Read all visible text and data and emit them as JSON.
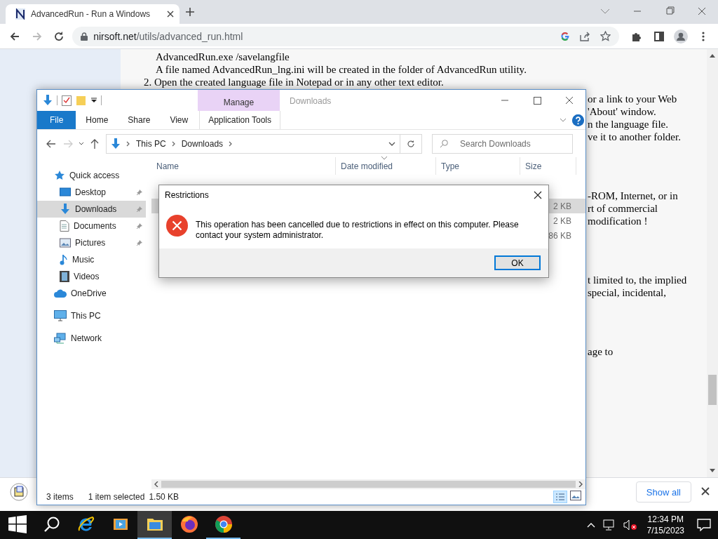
{
  "browser": {
    "tab": {
      "title": "AdvancedRun - Run a Windows"
    },
    "address": {
      "host": "nirsoft.net",
      "path": "/utils/advanced_run.html"
    },
    "page": {
      "lines": [
        {
          "kind": "plain",
          "text": "AdvancedRun.exe /savelangfile"
        },
        {
          "kind": "plain",
          "text": "A file named AdvancedRun_lng.ini will be created in the folder of AdvancedRun utility."
        },
        {
          "kind": "item",
          "marker": "2.",
          "text": "Open the created language file in Notepad or in any other text editor."
        }
      ],
      "fragments": [
        {
          "lines": [
            "or a link to your Web",
            "'About' window.",
            "n the language file.",
            "ve it to another folder."
          ]
        },
        {
          "lines": [
            "-ROM, Internet, or in",
            "rt of commercial",
            "modification !"
          ]
        },
        {
          "lines": [
            "t limited to, the implied",
            "special, incidental,"
          ]
        },
        {
          "lines": [
            "age to"
          ]
        }
      ]
    },
    "downloads_bar": {
      "button": "Show all"
    }
  },
  "explorer": {
    "title": "Downloads",
    "context_group": "Manage",
    "ribbon_tabs": [
      {
        "label": "File",
        "kind": "file"
      },
      {
        "label": "Home",
        "kind": "tab"
      },
      {
        "label": "Share",
        "kind": "tab"
      },
      {
        "label": "View",
        "kind": "tab"
      },
      {
        "label": "Application Tools",
        "kind": "contextual"
      }
    ],
    "breadcrumb": [
      "This PC",
      "Downloads"
    ],
    "search": {
      "placeholder": "Search Downloads"
    },
    "columns": [
      {
        "label": "Name",
        "sorted": false
      },
      {
        "label": "Date modified",
        "sorted": true
      },
      {
        "label": "Type",
        "sorted": false
      },
      {
        "label": "Size",
        "sorted": false
      }
    ],
    "nav": [
      {
        "label": "Quick access",
        "kind": "star",
        "selected": false,
        "children": [
          {
            "label": "Desktop",
            "kind": "desktop",
            "pinned": true,
            "selected": false
          },
          {
            "label": "Downloads",
            "kind": "download",
            "pinned": true,
            "selected": true
          },
          {
            "label": "Documents",
            "kind": "document",
            "pinned": true,
            "selected": false
          },
          {
            "label": "Pictures",
            "kind": "picture",
            "pinned": true,
            "selected": false
          },
          {
            "label": "Music",
            "kind": "music",
            "pinned": false,
            "selected": false
          },
          {
            "label": "Videos",
            "kind": "video",
            "pinned": false,
            "selected": false
          }
        ]
      },
      {
        "label": "OneDrive",
        "kind": "cloud",
        "selected": false
      },
      {
        "label": "This PC",
        "kind": "computer",
        "selected": false
      },
      {
        "label": "Network",
        "kind": "network",
        "selected": false
      }
    ],
    "rows": [
      {
        "size": "2 KB",
        "selected": true
      },
      {
        "size": "2 KB",
        "selected": false
      },
      {
        "size": "86 KB",
        "selected": false
      }
    ],
    "status": {
      "count": "3 items",
      "selection": "1 item selected",
      "size": "1.50 KB"
    }
  },
  "dialog": {
    "title": "Restrictions",
    "message": "This operation has been cancelled due to restrictions in effect on this computer. Please contact your system administrator.",
    "button": "OK"
  },
  "taskbar": {
    "apps": [
      {
        "kind": "start",
        "active": false,
        "running": false
      },
      {
        "kind": "search",
        "active": false,
        "running": false
      },
      {
        "kind": "ie",
        "active": false,
        "running": false
      },
      {
        "kind": "media",
        "active": false,
        "running": false
      },
      {
        "kind": "explorer",
        "active": true,
        "running": true
      },
      {
        "kind": "firefox",
        "active": false,
        "running": false
      },
      {
        "kind": "chrome",
        "active": false,
        "running": true
      }
    ],
    "clock": {
      "time": "12:34 PM",
      "date": "7/15/2023"
    }
  }
}
